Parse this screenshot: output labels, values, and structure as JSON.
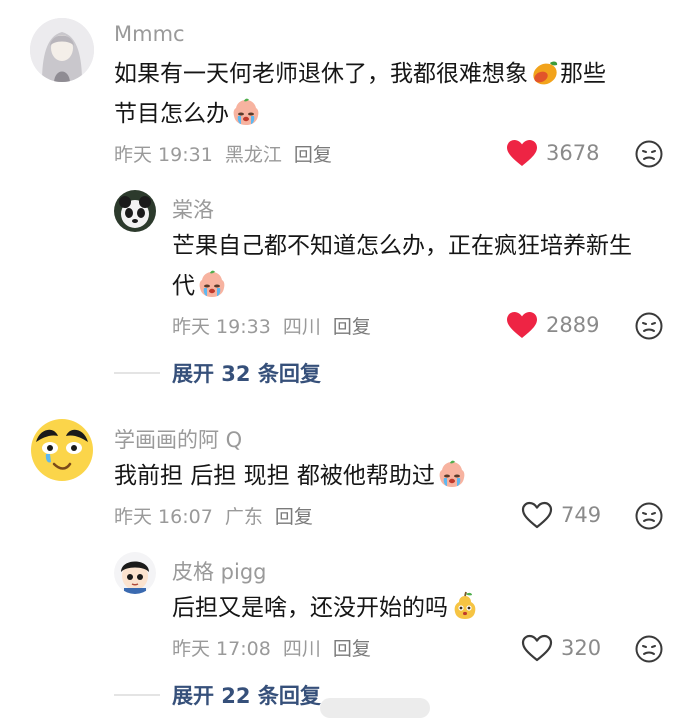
{
  "comments": [
    {
      "username": "Mmmc",
      "text_line1": "如果有一天何老师退休了，我都很难想象",
      "text_line1b": "那些",
      "text_line2": "节目怎么办",
      "time": "昨天 19:31",
      "location": "黑龙江",
      "reply_label": "回复",
      "likes": "3678",
      "liked": true,
      "emojis": [
        "mango-emoji",
        "crying-peach-emoji"
      ],
      "replies": [
        {
          "username": "棠洛",
          "text_line1": "芒果自己都不知道怎么办，正在疯狂培养新生",
          "text_line2": "代",
          "time": "昨天 19:33",
          "location": "四川",
          "reply_label": "回复",
          "likes": "2889",
          "liked": true,
          "emojis": [
            "crying-peach-emoji"
          ]
        }
      ],
      "expand_label": "展开 32 条回复"
    },
    {
      "username": "学画画的阿 Q",
      "text_line1": "我前担 后担 现担 都被他帮助过",
      "time": "昨天 16:07",
      "location": "广东",
      "reply_label": "回复",
      "likes": "749",
      "liked": false,
      "emojis": [
        "crying-peach-emoji"
      ],
      "replies": [
        {
          "username": "皮格 pigg",
          "text_line1": "后担又是啥，还没开始的吗",
          "time": "昨天 17:08",
          "location": "四川",
          "reply_label": "回复",
          "likes": "320",
          "liked": false,
          "emojis": [
            "pear-face-emoji"
          ]
        }
      ],
      "expand_label": "展开 22 条回复"
    }
  ],
  "colors": {
    "heart_active": "#ee2444",
    "meta_gray": "#9a9a9a",
    "expand_blue": "#36507a"
  }
}
